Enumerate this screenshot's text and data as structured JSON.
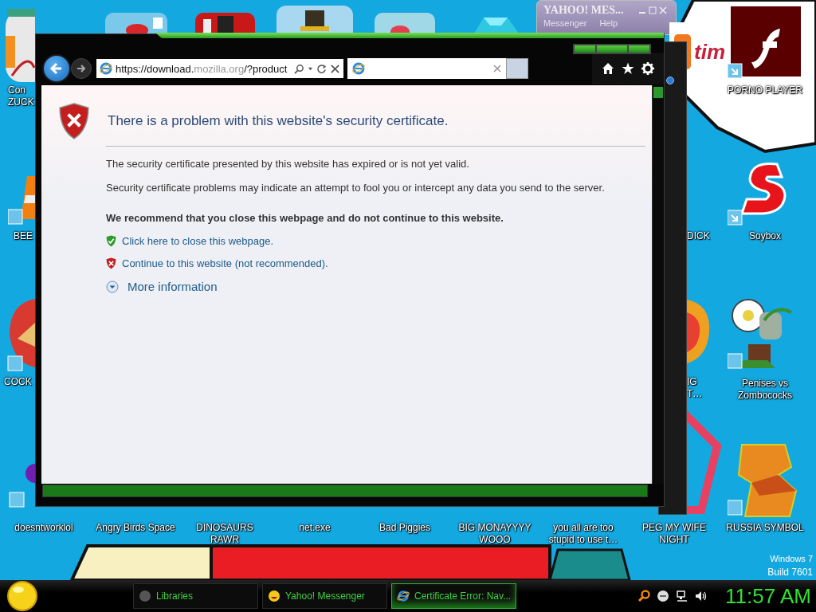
{
  "desktop_icons": [
    {
      "label": "Con ZUCK"
    },
    {
      "label": "PORNO PLAYER"
    },
    {
      "label": "BEE"
    },
    {
      "label": "DICK"
    },
    {
      "label": "Soybox"
    },
    {
      "label": "COCK"
    },
    {
      "label": "IG T…"
    },
    {
      "label": "Penises vs Zombococks"
    },
    {
      "label": "doesntworklol"
    },
    {
      "label": "Angry Birds Space"
    },
    {
      "label": "DINOSAURS RAWR"
    },
    {
      "label": "net.exe"
    },
    {
      "label": "Bad Piggies"
    },
    {
      "label": "BIG MONAYYYY WOOO"
    },
    {
      "label": "you all are too stupid to use t…"
    },
    {
      "label": "PEG MY WIFE NIGHT"
    },
    {
      "label": "RUSSIA SYMBOL"
    }
  ],
  "yahoo_window": {
    "title": "YAHOO! MES...",
    "menus": [
      "Messenger",
      "Help"
    ]
  },
  "back_window": {
    "text": "tim"
  },
  "browser": {
    "address": {
      "prefix": "https://download.",
      "domain": "mozilla.org",
      "path": "/?product"
    },
    "page": {
      "heading": "There is a problem with this website's security certificate.",
      "paragraphs": [
        "The security certificate presented by this website has expired or is not yet valid.",
        "Security certificate problems may indicate an attempt to fool you or intercept any data you send to the server."
      ],
      "recommendation": "We recommend that you close this webpage and do not continue to this website.",
      "links": [
        {
          "kind": "safe",
          "text": "Click here to close this webpage."
        },
        {
          "kind": "unsafe",
          "text": "Continue to this website (not recommended)."
        }
      ],
      "more_info": "More information"
    }
  },
  "os_version": [
    "Windows 7",
    "Build 7601"
  ],
  "taskbar": {
    "items": [
      {
        "label": "Libraries",
        "kind": "folder",
        "selected": false
      },
      {
        "label": "Yahoo! Messenger",
        "kind": "messenger",
        "selected": false
      },
      {
        "label": "Certificate Error: Nav...",
        "kind": "browser",
        "selected": true
      }
    ],
    "clock": "11:57 AM"
  }
}
